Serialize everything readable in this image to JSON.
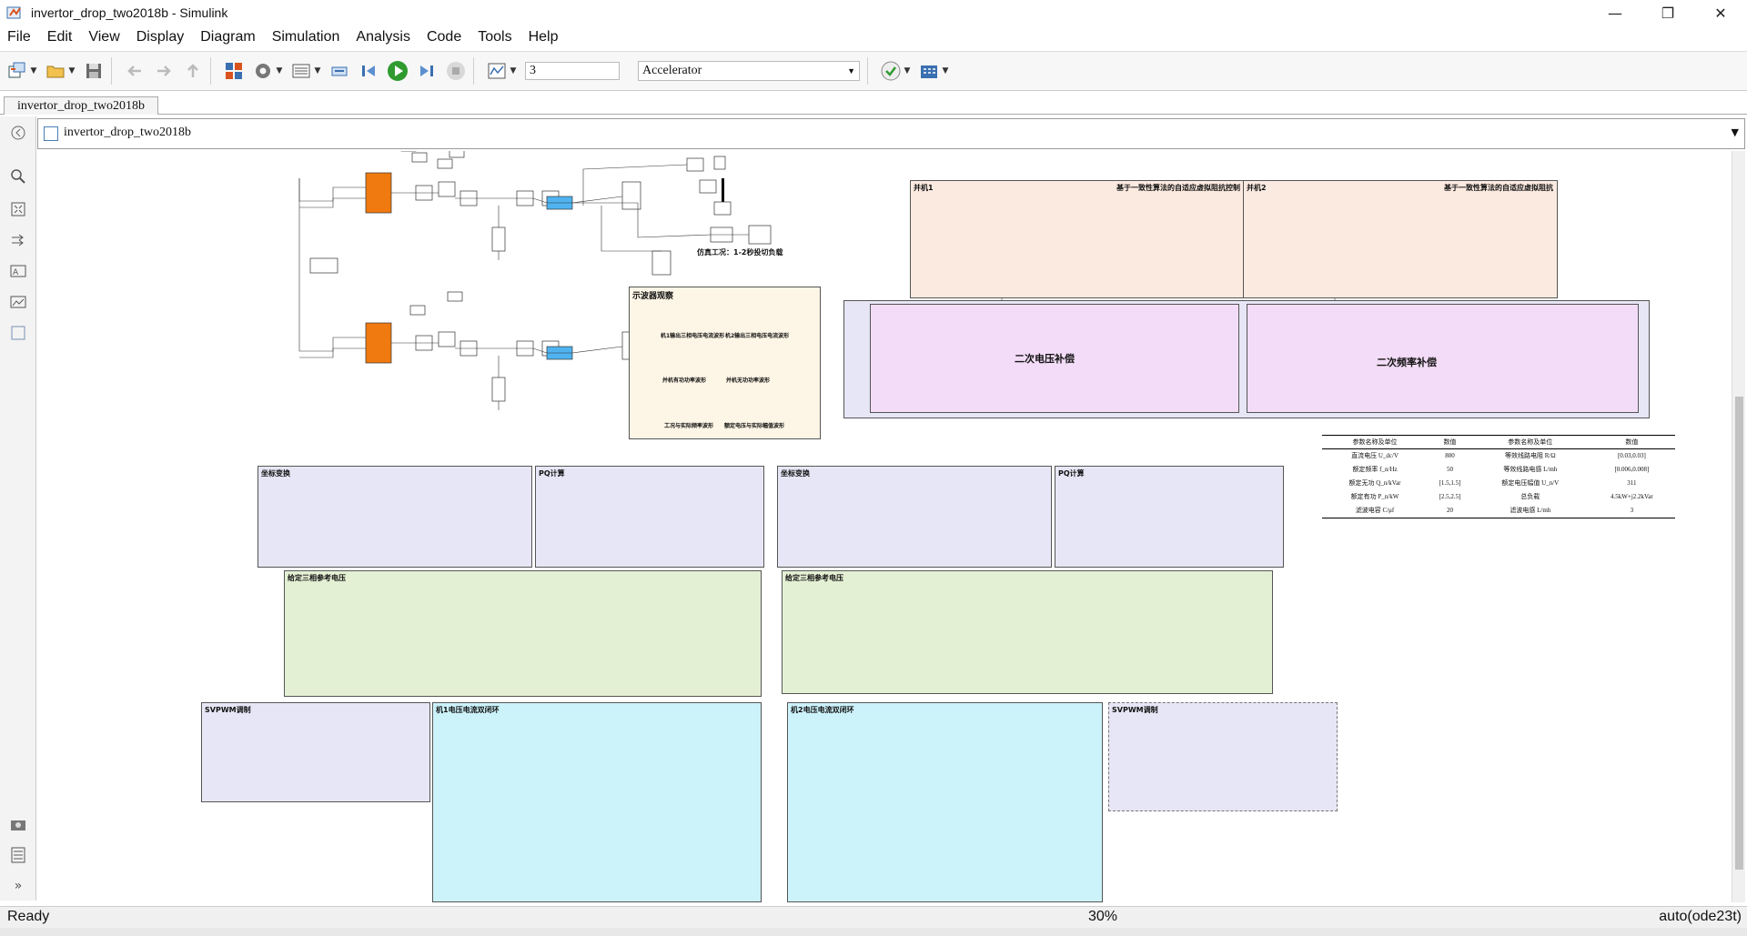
{
  "window": {
    "title": "invertor_drop_two2018b - Simulink",
    "controls": {
      "minimize": "—",
      "maximize": "❐",
      "close": "✕"
    }
  },
  "menu": {
    "items": [
      "File",
      "Edit",
      "View",
      "Display",
      "Diagram",
      "Simulation",
      "Analysis",
      "Code",
      "Tools",
      "Help"
    ],
    "mnemonics": [
      "F",
      "E",
      "V",
      "D",
      "g",
      "S",
      "A",
      "C",
      "T",
      "H"
    ]
  },
  "toolbar": {
    "icons": [
      "new-model-icon",
      "open-icon",
      "save-icon",
      "undo-icon",
      "redo-icon",
      "up-icon",
      "library-browser-icon",
      "model-config-icon",
      "model-explorer-icon",
      "update-diagram-icon",
      "step-back-icon",
      "run-icon",
      "step-forward-icon",
      "stop-icon",
      "simulation-data-inspector-icon",
      "check-icon",
      "build-icon"
    ],
    "stop_time": "3",
    "sim_mode": "Accelerator"
  },
  "tab": {
    "label": "invertor_drop_two2018b"
  },
  "address": {
    "path": "invertor_drop_two2018b"
  },
  "left_tools": [
    "back-icon",
    "zoom-icon",
    "fit-view-icon",
    "arrow-icon",
    "annotation-icon",
    "image-icon",
    "area-icon",
    "screenshot-icon",
    "explorer-bar-icon",
    "expand-icon"
  ],
  "diagram": {
    "load_note": "仿真工况：1-2秒投切负载",
    "scope_panel": {
      "title": "示波器观察",
      "labels": [
        "机1输出三相电压电流波形",
        "机2输出三相电压电流波形",
        "并机有功功率波形",
        "并机无功功率波形",
        "工况与实际频率波形",
        "额定电压与实际幅值波形"
      ]
    },
    "parallel1": {
      "title": "并机1",
      "subtitle": "基于一致性算法的自适应虚拟阻抗控制"
    },
    "parallel2": {
      "title": "并机2",
      "subtitle": "基于一致性算法的自适应虚拟阻抗"
    },
    "secondary_voltage": "二次电压补偿",
    "secondary_freq": "二次频率补偿",
    "coord_transform": "坐标变换",
    "pq_calc": "PQ计算",
    "three_phase_ref": "给定三相参考电压",
    "svpwm": "SVPWM调制",
    "loop1": "机1电压电流双闭环",
    "loop2": "机2电压电流双闭环",
    "param_table": {
      "headers": [
        "参数名称及单位",
        "数值",
        "参数名称及单位",
        "数值"
      ],
      "rows": [
        [
          "直流电压 U_dc/V",
          "800",
          "等效线路电阻 R/Ω",
          "[0.03,0.03]"
        ],
        [
          "额定频率 f_n/Hz",
          "50",
          "等效线路电感 L/mh",
          "[0.006,0.008]"
        ],
        [
          "额定无功 Q_n/kVar",
          "[1.5,1.5]",
          "额定电压幅值 U_n/V",
          "311"
        ],
        [
          "额定有功 P_n/kW",
          "[2.5,2.5]",
          "总负载",
          "4.5kW+j2.2kVar"
        ],
        [
          "滤波电容 C/μf",
          "20",
          "滤波电感 L/mh",
          "3"
        ]
      ]
    }
  },
  "status": {
    "ready": "Ready",
    "zoom": "30%",
    "solver": "auto(ode23t)"
  }
}
